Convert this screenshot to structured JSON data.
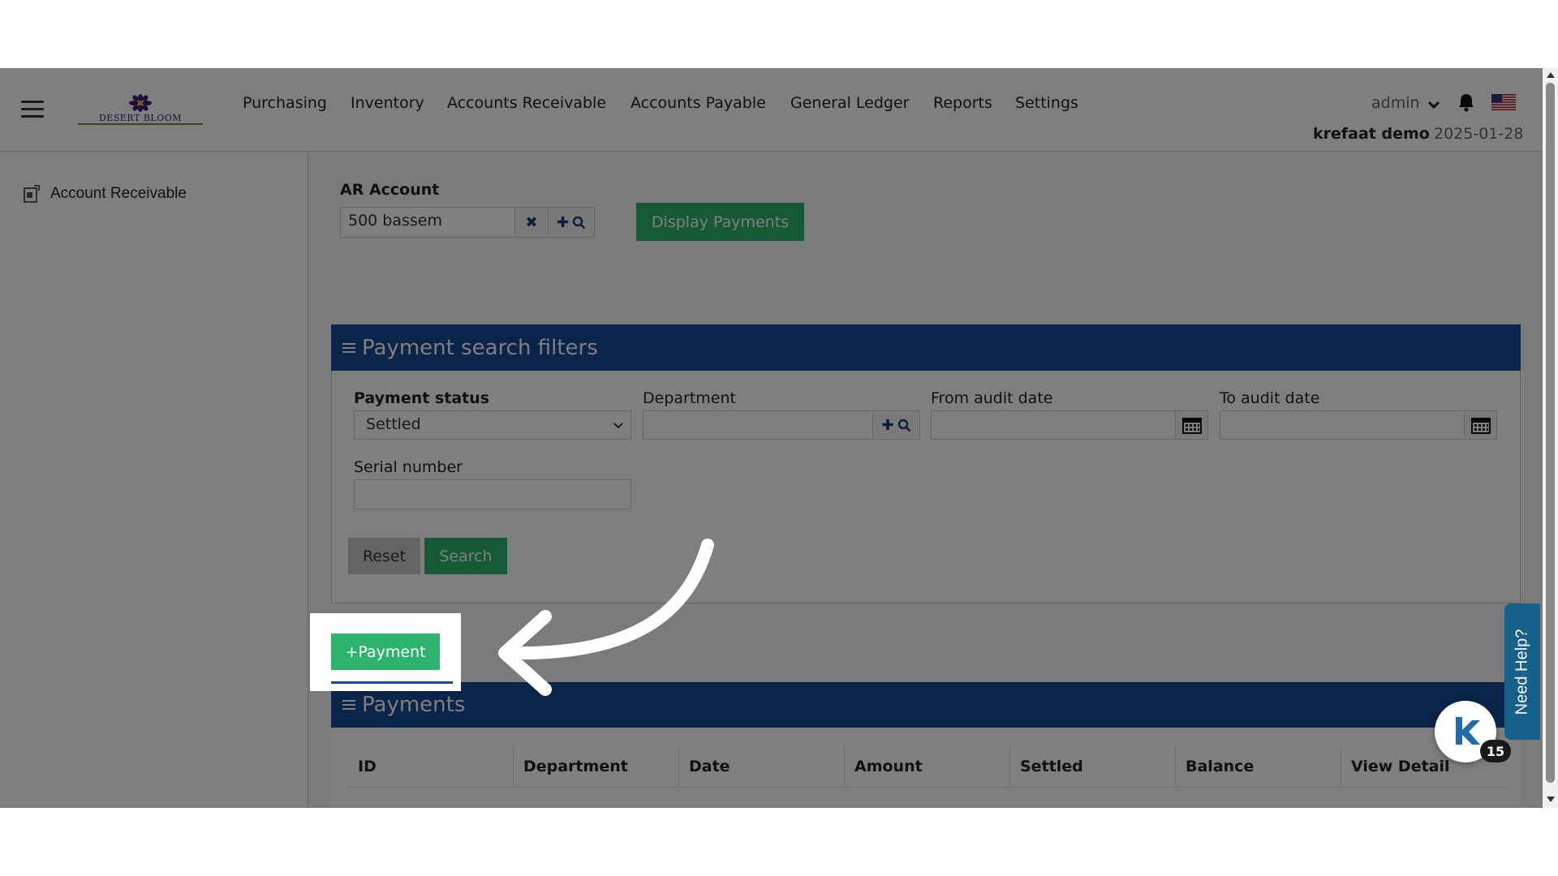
{
  "header": {
    "logo_text": "DESERT BLOOM",
    "nav": [
      "Purchasing",
      "Inventory",
      "Accounts Receivable",
      "Accounts Payable",
      "General Ledger",
      "Reports",
      "Settings"
    ],
    "user": "admin",
    "company": "krefaat demo",
    "date": "2025-01-28"
  },
  "sidebar": {
    "item": "Account Receivable"
  },
  "account": {
    "label": "AR Account",
    "value": "500 bassem",
    "display_button": "Display Payments"
  },
  "filters": {
    "title": "Payment search filters",
    "payment_status_label": "Payment status",
    "payment_status_value": "Settled",
    "department_label": "Department",
    "from_label": "From audit date",
    "to_label": "To audit date",
    "serial_label": "Serial number",
    "reset": "Reset",
    "search": "Search"
  },
  "add_payment": "+Payment",
  "payments": {
    "title": "Payments",
    "columns": [
      "ID",
      "Department",
      "Date",
      "Amount",
      "Settled",
      "Balance",
      "View Detail"
    ]
  },
  "help": {
    "label": "Need Help?",
    "badge": "15"
  },
  "colors": {
    "primary_green": "#2eb36e",
    "panel_blue": "#164a94",
    "help_blue": "#17608a"
  }
}
